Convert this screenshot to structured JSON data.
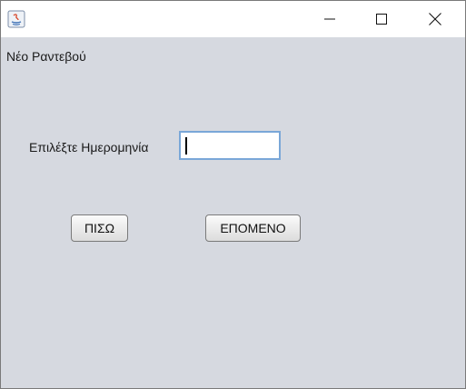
{
  "window": {
    "title": "",
    "app_icon": "java-icon",
    "controls": {
      "minimize_icon": "minimize-icon",
      "maximize_icon": "maximize-icon",
      "close_icon": "close-icon"
    }
  },
  "form": {
    "heading": "Νέο Ραντεβού",
    "date_label": "Επιλέξτε Ημερομηνία",
    "date_value": "",
    "back_label": "ΠΙΣΩ",
    "next_label": "ΕΠΟΜΕΝΟ"
  },
  "colors": {
    "background": "#d6d9e0",
    "input_focus_border": "#7aa7d8"
  }
}
